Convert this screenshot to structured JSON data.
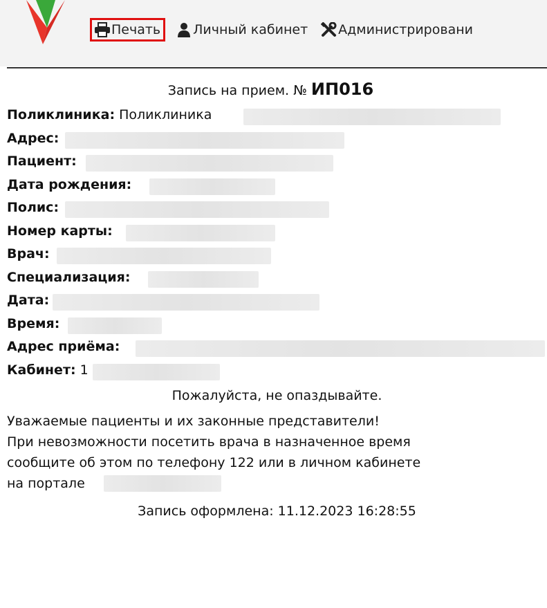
{
  "toolbar": {
    "print_label": "Печать",
    "cabinet_label": "Личный кабинет",
    "admin_label": "Администрировани"
  },
  "ticket": {
    "title_prefix": "Запись на прием. №",
    "number": "ИП016",
    "clinic": {
      "label": "Поликлиника:",
      "value": "Поликлиника"
    },
    "address": {
      "label": "Адрес:"
    },
    "patient": {
      "label": "Пациент:"
    },
    "birth_date": {
      "label": "Дата рождения:"
    },
    "policy": {
      "label": "Полис:"
    },
    "card_number": {
      "label": "Номер карты:"
    },
    "doctor": {
      "label": "Врач:"
    },
    "specialization": {
      "label": "Специализация:"
    },
    "date": {
      "label": "Дата:"
    },
    "time": {
      "label": "Время:"
    },
    "reception_address": {
      "label": "Адрес приёма:"
    },
    "cabinet": {
      "label": "Кабинет:",
      "value": "1"
    },
    "notice": "Пожалуйста, не опаздывайте.",
    "message_lines": [
      "Уважаемые пациенты и их законные представители!",
      "При невозможности посетить врача в назначенное время",
      "сообщите об этом по телефону 122 или в личном кабинете",
      "на портале"
    ],
    "issued": "Запись оформлена: 11.12.2023 16:28:55"
  },
  "colors": {
    "highlight_border": "#e01010",
    "logo_red": "#e8352b",
    "logo_green": "#3aa83a"
  },
  "icons": {
    "print": "printer-icon",
    "cabinet": "user-icon",
    "admin": "tools-icon"
  }
}
